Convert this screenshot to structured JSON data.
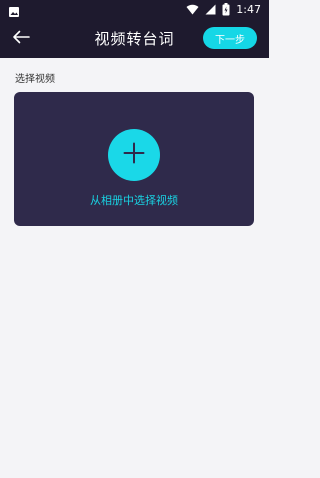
{
  "status_bar": {
    "time": "1:47",
    "left_icon": "image-icon",
    "icons": [
      "wifi-icon",
      "signal-icon",
      "battery-icon"
    ]
  },
  "nav": {
    "back_icon": "arrow-left-icon",
    "title": "视频转台词",
    "next_label": "下一步"
  },
  "main": {
    "section_label": "选择视频",
    "picker_label": "从相册中选择视频",
    "picker_icon": "plus-icon"
  },
  "colors": {
    "header_bg": "#1e1a2e",
    "accent": "#15d7e6",
    "card_bg": "#2f2a4b",
    "page_bg": "#f4f4f7"
  }
}
